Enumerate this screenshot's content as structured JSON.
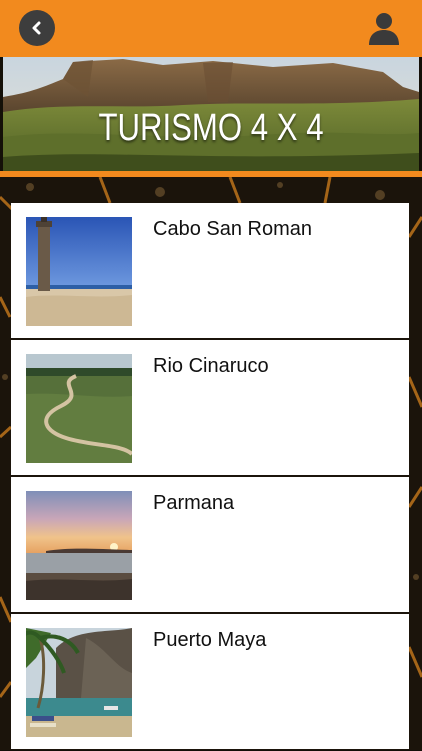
{
  "header": {
    "back_icon": "chevron-left-icon",
    "profile_icon": "user-icon",
    "accent_color": "#f28a1e"
  },
  "banner": {
    "title": "TURISMO 4 X 4"
  },
  "destinations": [
    {
      "title": "Cabo San Roman"
    },
    {
      "title": "Rio Cinaruco"
    },
    {
      "title": "Parmana"
    },
    {
      "title": "Puerto Maya"
    }
  ]
}
